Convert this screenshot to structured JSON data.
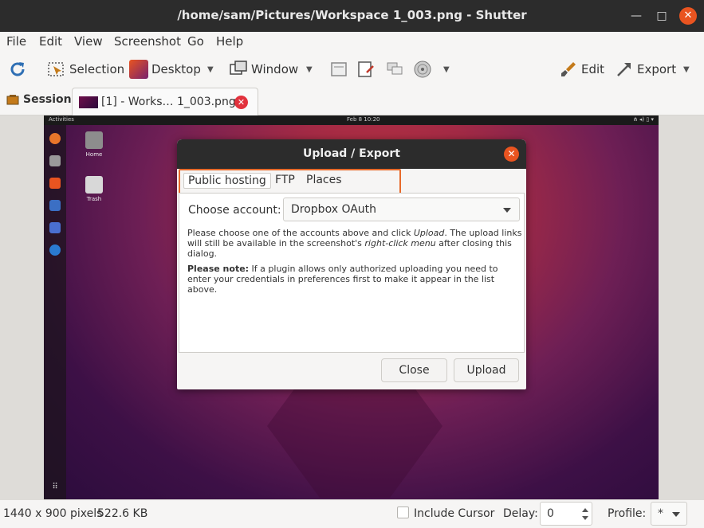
{
  "window": {
    "title": "/home/sam/Pictures/Workspace 1_003.png - Shutter",
    "minimize": "—",
    "maximize": "□",
    "close": "✕"
  },
  "menu": [
    "File",
    "Edit",
    "View",
    "Screenshot",
    "Go",
    "Help"
  ],
  "toolbar": {
    "selection": "Selection",
    "desktop": "Desktop",
    "window": "Window",
    "edit": "Edit",
    "export": "Export"
  },
  "tabs": {
    "session": "Session",
    "document": "[1] - Works… 1_003.png"
  },
  "screenshot": {
    "activities": "Activities",
    "clock": "Feb 8  10:20",
    "home_label": "Home",
    "trash_label": "Trash"
  },
  "dialog": {
    "title": "Upload / Export",
    "tabs": [
      "Public hosting",
      "FTP",
      "Places"
    ],
    "account_label": "Choose account:",
    "account_value": "Dropbox OAuth",
    "para1_a": "Please choose one of the accounts above and click ",
    "para1_b": "Upload",
    "para1_c": ". The upload links will still be available in the screenshot's ",
    "para1_d": "right-click menu",
    "para1_e": " after closing this dialog.",
    "para2_bold": "Please note:",
    "para2_rest": " If a plugin allows only authorized uploading you need to enter your credentials in preferences first to make it appear in the list above.",
    "close_button": "Close",
    "upload_button": "Upload"
  },
  "status": {
    "dimensions": "1440 x 900 pixels",
    "size": "522.6 KB",
    "include_cursor": "Include Cursor",
    "delay_label": "Delay:",
    "delay_value": "0",
    "profile_label": "Profile:",
    "profile_value": "*"
  },
  "colors": {
    "accent": "#e95420",
    "highlight": "#e76a2a"
  }
}
